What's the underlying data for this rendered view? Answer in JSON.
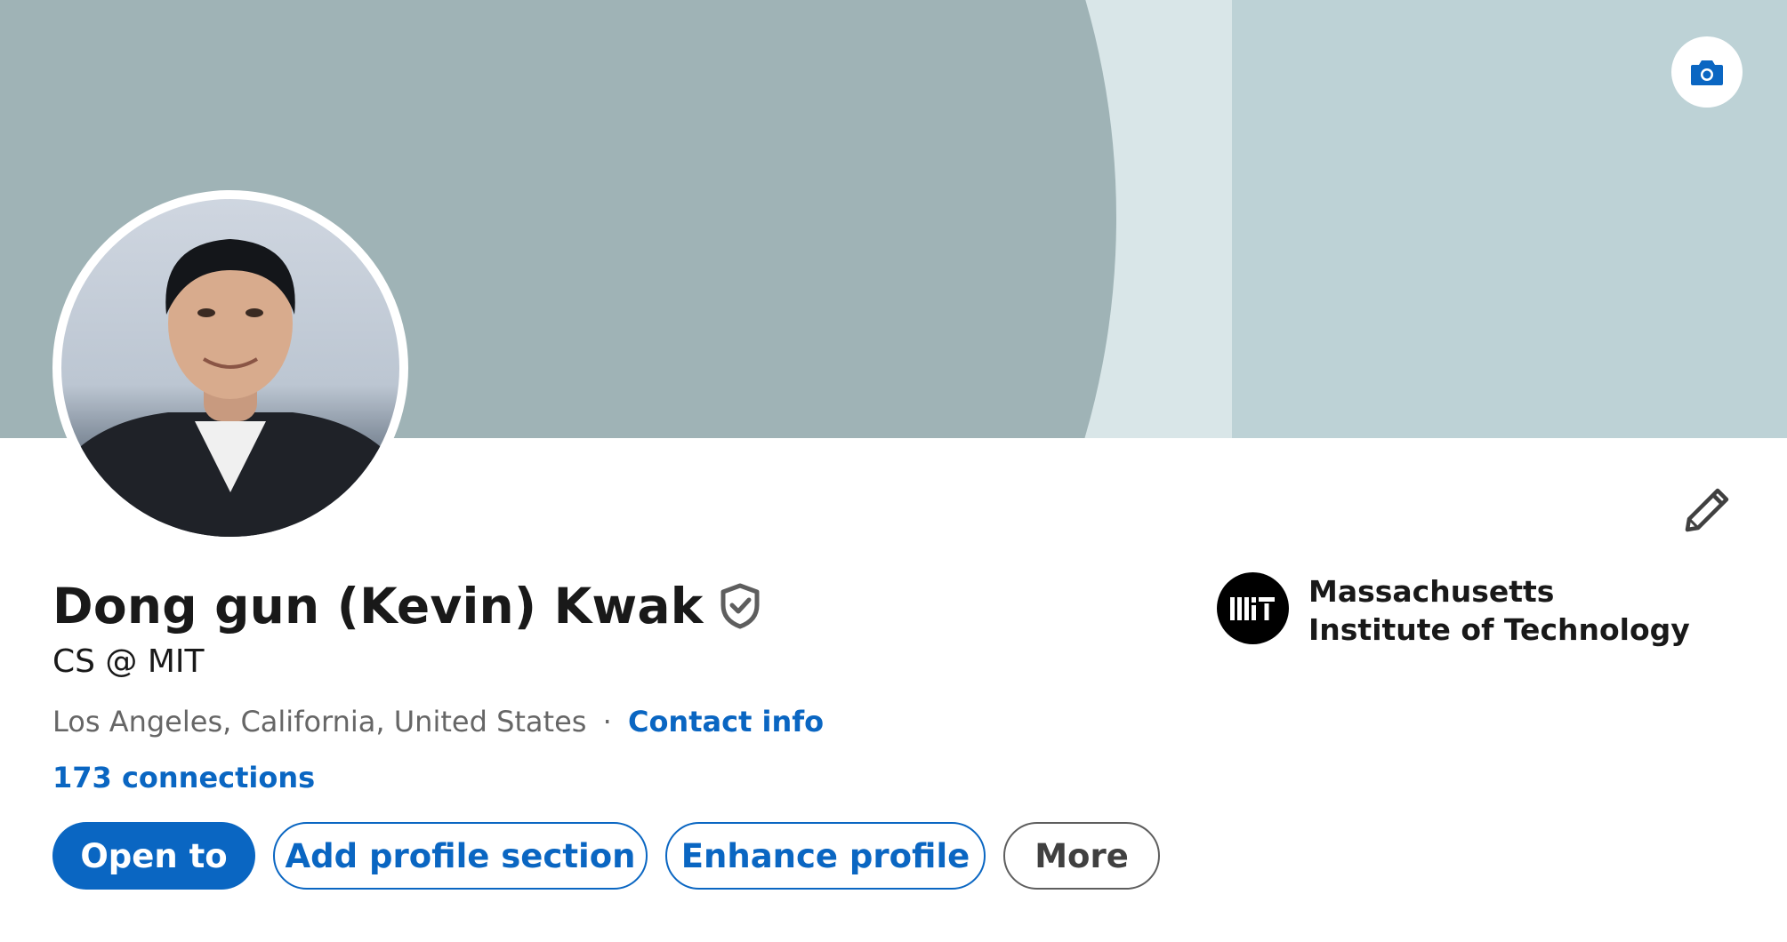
{
  "profile": {
    "name": "Dong gun (Kevin) Kwak",
    "headline": "CS @ MIT",
    "location": "Los Angeles, California, United States",
    "separator": "·",
    "contact_info_label": "Contact info",
    "connections_label": "173 connections"
  },
  "education": {
    "school_name": "Massachusetts Institute of Technology",
    "logo_text": "MIT"
  },
  "actions": {
    "open_to": "Open to",
    "add_profile_section": "Add profile section",
    "enhance_profile": "Enhance profile",
    "more": "More"
  },
  "icons": {
    "banner_camera": "camera-icon",
    "edit": "pencil-icon",
    "verified": "verified-shield-icon"
  },
  "colors": {
    "accent": "#0a66c2",
    "text_primary": "#191919",
    "text_secondary": "#666666",
    "banner_dark": "#9fb3b6",
    "banner_light": "#bdd2d6"
  }
}
